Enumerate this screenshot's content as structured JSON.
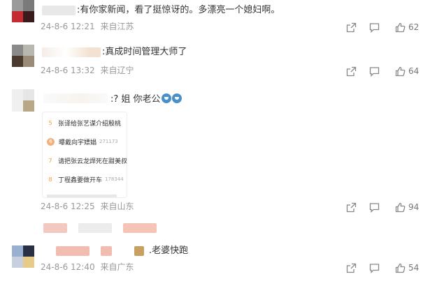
{
  "comments": [
    {
      "text": ":有你家新闻，看了挺惊讶的。多漂亮一个媳妇啊。",
      "date": "24-8-6 12:21",
      "location": "来自江苏",
      "likes": "62"
    },
    {
      "text": ":真成时间管理大师了",
      "date": "24-8-6 13:32",
      "location": "来自辽宁",
      "likes": "64"
    },
    {
      "text": ":? 姐 你老公",
      "date": "24-8-6 12:25",
      "location": "来自山东",
      "likes": "94",
      "hot_list": [
        {
          "rank": "5",
          "title": "张译给张艺谋介绍殷桃",
          "hot": ""
        },
        {
          "rank": "6",
          "title": "曝戴向宇嫖娼",
          "hot": "271173"
        },
        {
          "rank": "7",
          "title": "请把张云龙焊死在甜美叔",
          "hot": ""
        },
        {
          "rank": "8",
          "title": "丁程鑫要做开车",
          "hot": "178344"
        }
      ]
    },
    {
      "text": ".老婆快跑",
      "date": "24-8-6 12:40",
      "location": "来自广东",
      "likes": "54"
    }
  ],
  "colors": {
    "meta": "#999999",
    "text": "#333333",
    "icon": "#888888",
    "rank_accent": "#f0a030"
  },
  "icons": [
    "share-icon",
    "comment-icon",
    "like-icon",
    "emoji-icon"
  ]
}
